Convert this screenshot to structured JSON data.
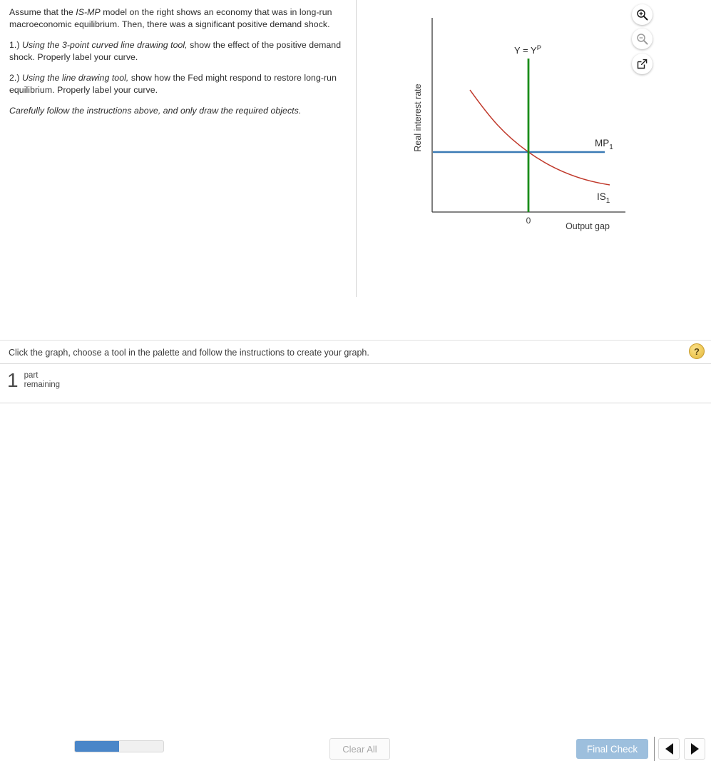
{
  "question": {
    "intro_1": "Assume that the ",
    "intro_model": "IS-MP",
    "intro_2": " model on the right shows an economy that was in long-run macroeconomic equilibrium. Then, there was a significant positive demand shock.",
    "item1_prefix": "1.) ",
    "item1_italic": "Using the 3-point curved line drawing tool,",
    "item1_rest": " show the effect of the positive demand shock. Properly label your curve.",
    "item2_prefix": "2.) ",
    "item2_italic": "Using the line drawing tool,",
    "item2_rest": " show how the Fed might respond to restore long-run equilibrium. Properly label your curve.",
    "note": "Carefully follow the instructions above, and only draw the required objects."
  },
  "graph_tools": {
    "zoom_in_icon": "magnifier-plus-icon",
    "zoom_out_icon": "magnifier-minus-icon",
    "expand_icon": "expand-arrow-icon"
  },
  "status": {
    "text": "Click the graph, choose a tool in the palette and follow the instructions to create your graph.",
    "help_label": "?"
  },
  "action_bar": {
    "parts_count": "1",
    "parts_label_line1": "part",
    "parts_label_line2": "remaining",
    "progress_percent": 50,
    "clear_all_label": "Clear All",
    "final_check_label": "Final Check",
    "prev_icon": "triangle-left-icon",
    "next_icon": "triangle-right-icon"
  },
  "colors": {
    "is_curve": "#c0392b",
    "mp_line": "#3a7ab5",
    "potential_output_line": "#1a8c1a",
    "axis": "#3a3a3a",
    "progress_fill": "#4a86c8",
    "final_check_bg": "#9dbfdd",
    "help_bg": "#f2cf63"
  },
  "chart_data": {
    "type": "line",
    "title": "",
    "xlabel": "Output gap",
    "ylabel": "Real interest rate",
    "xtick_labels": [
      "0"
    ],
    "ytick_labels": [],
    "grid": false,
    "legend": "inline-labels",
    "axis_origin_label": "0",
    "series": [
      {
        "name": "IS_1",
        "label_text": "IS",
        "label_sub": "1",
        "color": "#c0392b",
        "shape": "downward-sloping-convex-curve",
        "points": [
          {
            "x": -0.62,
            "y": 0.88
          },
          {
            "x": -0.4,
            "y": 0.66
          },
          {
            "x": -0.18,
            "y": 0.5
          },
          {
            "x": 0.0,
            "y": 0.4
          },
          {
            "x": 0.22,
            "y": 0.29
          },
          {
            "x": 0.5,
            "y": 0.2
          },
          {
            "x": 0.8,
            "y": 0.14
          },
          {
            "x": 1.0,
            "y": 0.12
          }
        ]
      },
      {
        "name": "MP_1",
        "label_text": "MP",
        "label_sub": "1",
        "color": "#3a7ab5",
        "shape": "horizontal-line",
        "y_value": 0.4,
        "x_from": -1.0,
        "x_to": 0.93
      },
      {
        "name": "Y = Y^P",
        "label_text": "Y = Y",
        "label_sup": "P",
        "color": "#1a8c1a",
        "shape": "vertical-line",
        "x_value": 0.0,
        "y_from": 0.0,
        "y_to": 0.86
      }
    ]
  }
}
